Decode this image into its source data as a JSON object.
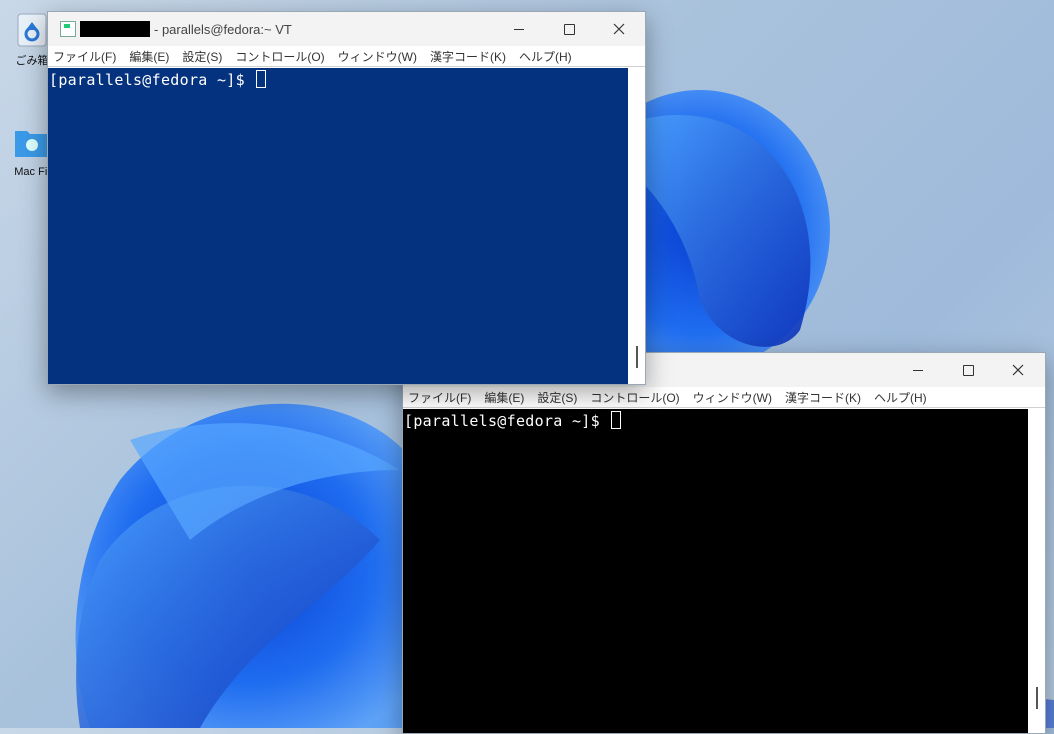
{
  "desktop": {
    "icons": [
      {
        "label": "ごみ箱",
        "icon": "recycle-bin-icon"
      },
      {
        "label": "Mac Fil",
        "icon": "mac-folder-icon"
      }
    ]
  },
  "window1": {
    "title": "- parallels@fedora:~ VT",
    "menu": [
      "ファイル(F)",
      "編集(E)",
      "設定(S)",
      "コントロール(O)",
      "ウィンドウ(W)",
      "漢字コード(K)",
      "ヘルプ(H)"
    ],
    "prompt": "[parallels@fedora ~]$ ",
    "bg_color": "#04327e"
  },
  "window2": {
    "menu": [
      "ファイル(F)",
      "編集(E)",
      "設定(S)",
      "コントロール(O)",
      "ウィンドウ(W)",
      "漢字コード(K)",
      "ヘルプ(H)"
    ],
    "prompt": "[parallels@fedora ~]$ ",
    "bg_color": "#000000"
  }
}
